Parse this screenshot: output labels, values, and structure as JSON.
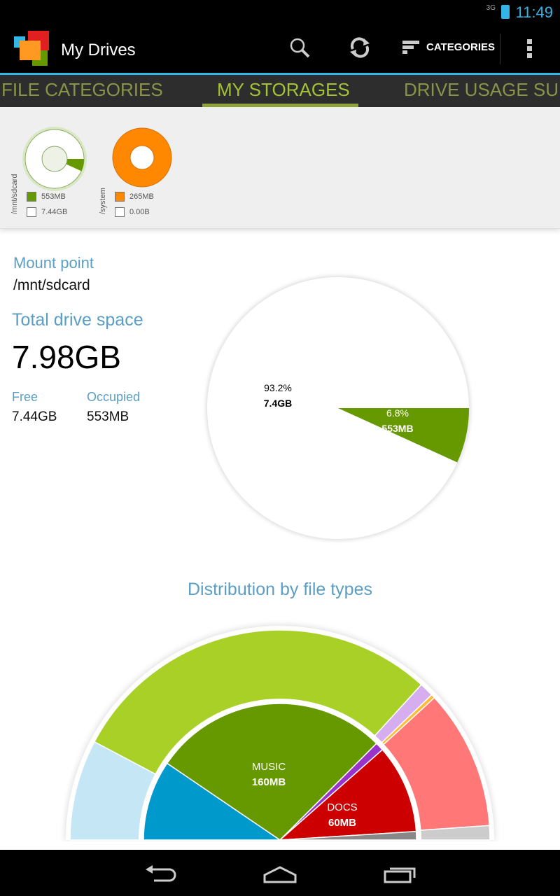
{
  "status_bar": {
    "network": "3G",
    "time": "11:49"
  },
  "action_bar": {
    "title": "My Drives",
    "categories_label": "CATEGORIES",
    "icons": [
      "app-logo",
      "search-icon",
      "refresh-icon",
      "categories-icon",
      "overflow-menu-icon"
    ]
  },
  "tabs": [
    {
      "label": "FILE CATEGORIES"
    },
    {
      "label": "MY STORAGES",
      "active": true
    },
    {
      "label": "DRIVE USAGE SUN"
    }
  ],
  "storages": [
    {
      "mount": "/mnt/sdcard",
      "used": "553MB",
      "free": "7.44GB",
      "used_fraction": 0.068,
      "color": "#669900"
    },
    {
      "mount": "/system",
      "used": "265MB",
      "free": "0.00B",
      "used_fraction": 1.0,
      "color": "#ff8800"
    }
  ],
  "details": {
    "mount_label": "Mount point",
    "mount_value": "/mnt/sdcard",
    "total_label": "Total drive space",
    "total_value": "7.98GB",
    "free_label": "Free",
    "free_value": "7.44GB",
    "occupied_label": "Occupied",
    "occupied_value": "553MB"
  },
  "chart_data": [
    {
      "type": "pie",
      "slices": [
        {
          "pct": "93.2%",
          "value": "7.4GB",
          "fraction": 0.932,
          "color": "#ffffff"
        },
        {
          "pct": "6.8%",
          "value": "553MB",
          "fraction": 0.068,
          "color": "#669900"
        }
      ]
    },
    {
      "type": "pie",
      "title": "Distribution by file types",
      "shape": "half-donut two rings",
      "inner": [
        {
          "fraction": 0.19,
          "color": "#0099cc"
        },
        {
          "label": "MUSIC",
          "value": "160MB",
          "fraction": 0.56,
          "color": "#669900"
        },
        {
          "fraction": 0.02,
          "color": "#9933cc"
        },
        {
          "label": "DOCS",
          "value": "60MB",
          "fraction": 0.21,
          "color": "#cc0000"
        },
        {
          "fraction": 0.02,
          "color": "#888888"
        }
      ],
      "outer": [
        {
          "fraction": 0.155,
          "color": "#c5e6f5"
        },
        {
          "fraction": 0.58,
          "color": "#a8d027"
        },
        {
          "fraction": 0.022,
          "color": "#d6aef0"
        },
        {
          "fraction": 0.006,
          "color": "#ffbb33"
        },
        {
          "fraction": 0.215,
          "color": "#ff7777"
        },
        {
          "fraction": 0.022,
          "color": "#cccccc"
        }
      ]
    }
  ]
}
